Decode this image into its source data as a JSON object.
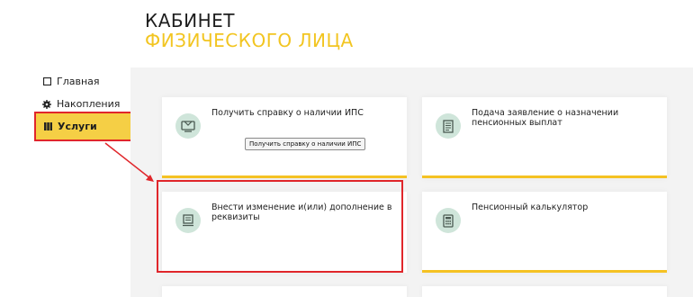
{
  "header": {
    "title_line1": "КАБИНЕТ",
    "title_line2": "ФИЗИЧЕСКОГО ЛИЦА"
  },
  "sidebar": {
    "items": [
      {
        "label": "Главная",
        "icon": "square-icon"
      },
      {
        "label": "Накопления",
        "icon": "gear-icon"
      },
      {
        "label": "Услуги",
        "icon": "grid-icon",
        "active": true
      }
    ]
  },
  "cards": [
    {
      "title": "Получить справку о наличии ИПС",
      "button": "Получить справку о наличии ИПС",
      "icon": "certificate-icon"
    },
    {
      "title": "Подача заявление о назначении пенсионных выплат",
      "icon": "document-icon"
    },
    {
      "title": "Внести изменение и(или) дополнение в реквизиты",
      "icon": "requisites-icon"
    },
    {
      "title": "Пенсионный калькулятор",
      "icon": "calculator-icon"
    }
  ],
  "colors": {
    "accent": "#f2c521",
    "highlight": "#e0262b",
    "icon_bg": "#cfe5da",
    "content_bg": "#f3f3f3"
  }
}
